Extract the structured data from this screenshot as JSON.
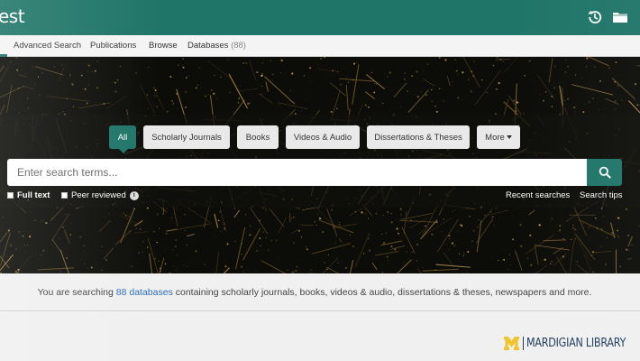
{
  "header": {
    "brand": "est",
    "history_icon": "history-icon",
    "folder_icon": "folder-icon"
  },
  "nav": {
    "items": [
      {
        "label": "Advanced Search"
      },
      {
        "label": "Publications"
      },
      {
        "label": "Browse"
      },
      {
        "label": "Databases",
        "count": "(88)"
      }
    ]
  },
  "search": {
    "tabs": [
      {
        "label": "All",
        "active": true
      },
      {
        "label": "Scholarly Journals"
      },
      {
        "label": "Books"
      },
      {
        "label": "Videos & Audio"
      },
      {
        "label": "Dissertations & Theses"
      },
      {
        "label": "More"
      }
    ],
    "placeholder": "Enter search terms...",
    "search_icon": "magnifier-icon",
    "full_text_label": "Full text",
    "peer_reviewed_label": "Peer reviewed",
    "info_icon": "info-icon",
    "recent_searches": "Recent searches",
    "search_tips": "Search tips"
  },
  "info_bar": {
    "prefix": "You are searching ",
    "link": "88 databases",
    "suffix": " containing scholarly journals, books, videos & audio, dissertations & theses, newspapers and more."
  },
  "footer": {
    "logo_mark": "M",
    "logo_text": "MARDIGIAN LIBRARY",
    "colors": {
      "logo_gold": "#f0c42c",
      "logo_navy": "#1f3d5c"
    }
  },
  "colors": {
    "brand_teal": "#1f7568",
    "link_blue": "#2a6db5"
  }
}
